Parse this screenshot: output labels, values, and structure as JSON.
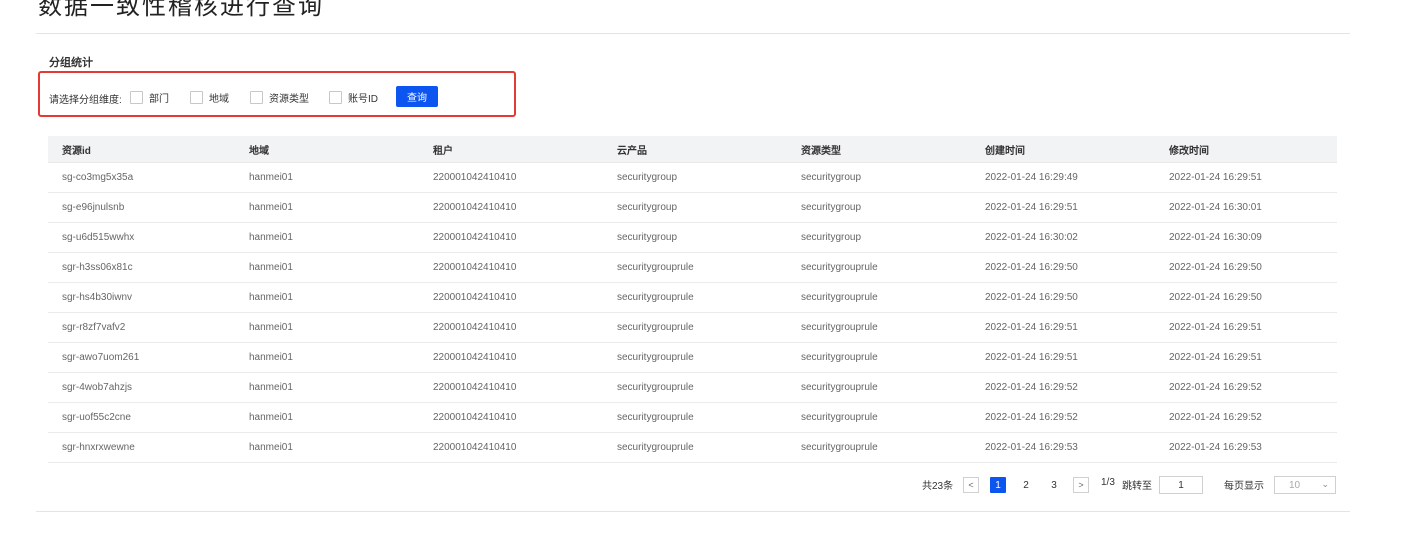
{
  "header": {
    "title": "数据一致性稽核进行查询"
  },
  "section": {
    "title": "分组统计"
  },
  "filter": {
    "label": "请选择分组维度:",
    "options": [
      "部门",
      "地域",
      "资源类型",
      "账号ID"
    ],
    "query_label": "查询"
  },
  "table": {
    "columns": [
      "资源id",
      "地域",
      "租户",
      "云产品",
      "资源类型",
      "创建时间",
      "修改时间"
    ],
    "rows": [
      [
        "sg-co3mg5x35a",
        "hanmei01",
        "220001042410410",
        "securitygroup",
        "securitygroup",
        "2022-01-24 16:29:49",
        "2022-01-24 16:29:51"
      ],
      [
        "sg-e96jnulsnb",
        "hanmei01",
        "220001042410410",
        "securitygroup",
        "securitygroup",
        "2022-01-24 16:29:51",
        "2022-01-24 16:30:01"
      ],
      [
        "sg-u6d515wwhx",
        "hanmei01",
        "220001042410410",
        "securitygroup",
        "securitygroup",
        "2022-01-24 16:30:02",
        "2022-01-24 16:30:09"
      ],
      [
        "sgr-h3ss06x81c",
        "hanmei01",
        "220001042410410",
        "securitygrouprule",
        "securitygrouprule",
        "2022-01-24 16:29:50",
        "2022-01-24 16:29:50"
      ],
      [
        "sgr-hs4b30iwnv",
        "hanmei01",
        "220001042410410",
        "securitygrouprule",
        "securitygrouprule",
        "2022-01-24 16:29:50",
        "2022-01-24 16:29:50"
      ],
      [
        "sgr-r8zf7vafv2",
        "hanmei01",
        "220001042410410",
        "securitygrouprule",
        "securitygrouprule",
        "2022-01-24 16:29:51",
        "2022-01-24 16:29:51"
      ],
      [
        "sgr-awo7uom261",
        "hanmei01",
        "220001042410410",
        "securitygrouprule",
        "securitygrouprule",
        "2022-01-24 16:29:51",
        "2022-01-24 16:29:51"
      ],
      [
        "sgr-4wob7ahzjs",
        "hanmei01",
        "220001042410410",
        "securitygrouprule",
        "securitygrouprule",
        "2022-01-24 16:29:52",
        "2022-01-24 16:29:52"
      ],
      [
        "sgr-uof55c2cne",
        "hanmei01",
        "220001042410410",
        "securitygrouprule",
        "securitygrouprule",
        "2022-01-24 16:29:52",
        "2022-01-24 16:29:52"
      ],
      [
        "sgr-hnxrxwewne",
        "hanmei01",
        "220001042410410",
        "securitygrouprule",
        "securitygrouprule",
        "2022-01-24 16:29:53",
        "2022-01-24 16:29:53"
      ]
    ]
  },
  "pagination": {
    "total": "共23条",
    "prev_icon": "chevron-left-icon",
    "next_icon": "chevron-right-icon",
    "pages": [
      "1",
      "2",
      "3"
    ],
    "current_page": "1",
    "page_info": "1/3",
    "jump_label": "跳转至",
    "jump_value": "1",
    "size_label": "每页显示",
    "size_value": "10",
    "accent": "#0d55f0"
  },
  "colors": {
    "primary": "#0d55f0",
    "highlight_border": "#e53935",
    "header_bg": "#f2f3f5"
  }
}
